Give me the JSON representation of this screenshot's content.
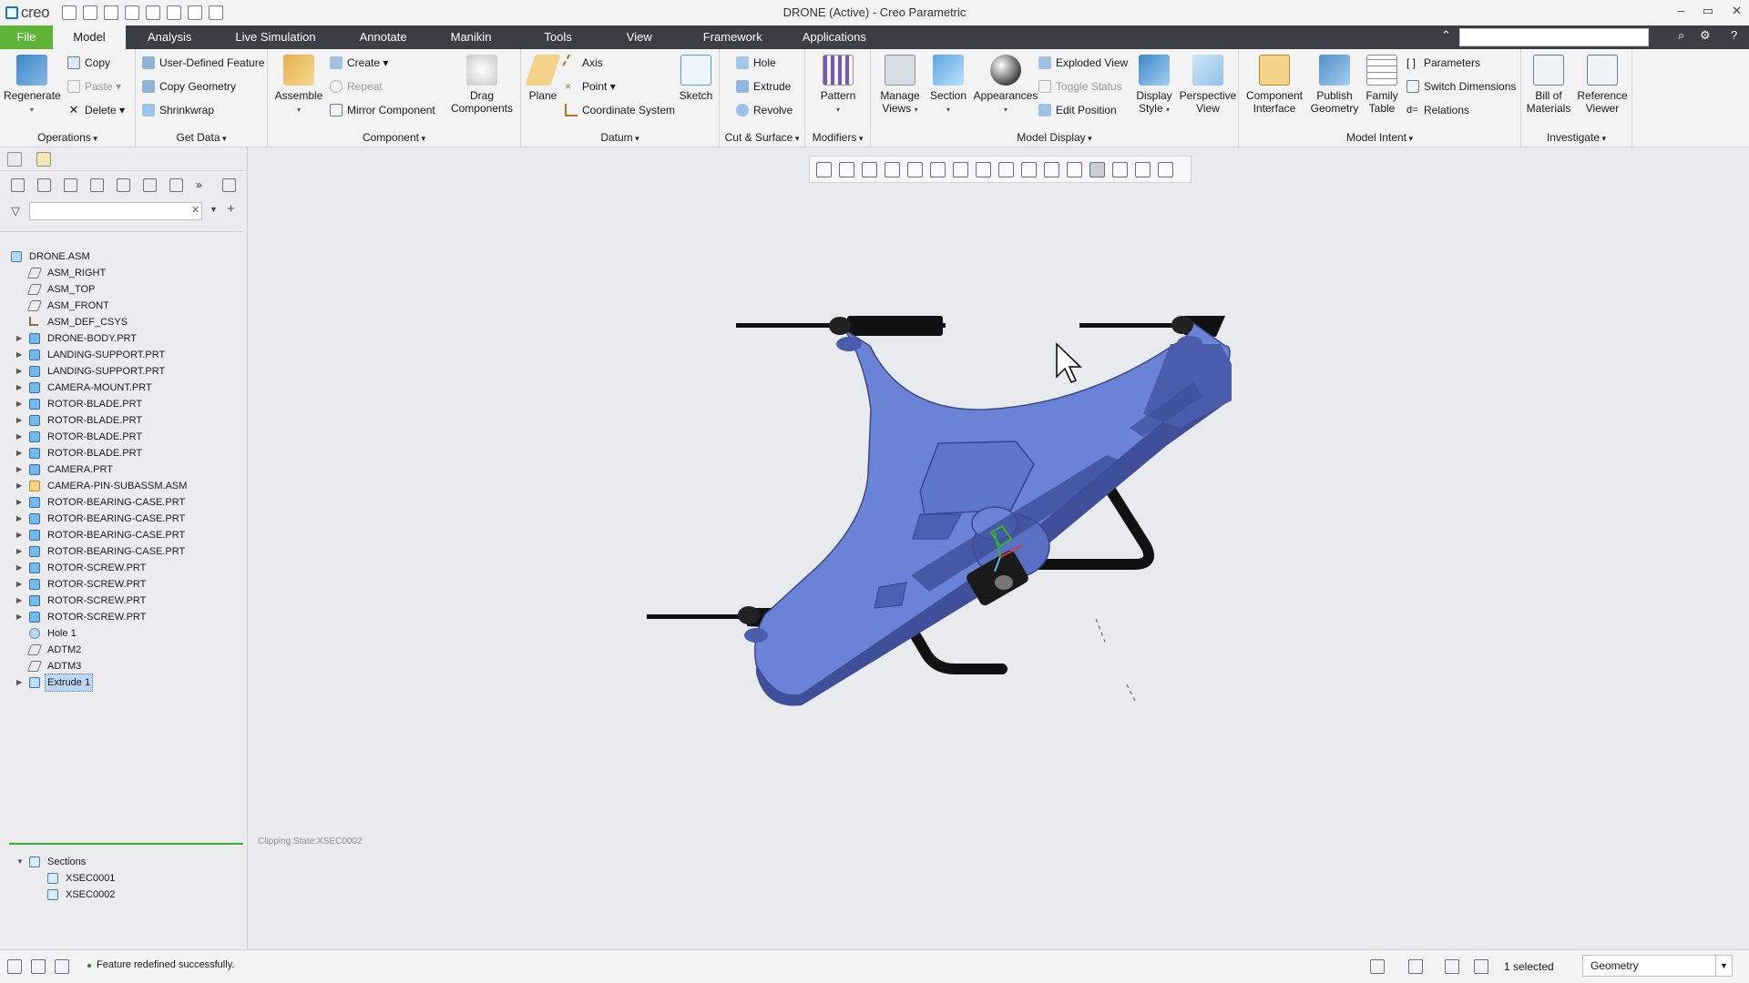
{
  "app": {
    "logo": "creo",
    "window_title": "DRONE (Active) - Creo Parametric",
    "search_placeholder": ""
  },
  "menu": {
    "tabs": [
      "File",
      "Model",
      "Analysis",
      "Live Simulation",
      "Annotate",
      "Manikin",
      "Tools",
      "View",
      "Framework",
      "Applications"
    ],
    "active": "Model"
  },
  "ribbon": {
    "operations": {
      "regenerate": "Regenerate",
      "copy": "Copy",
      "paste": "Paste",
      "delete": "Delete",
      "label": "Operations"
    },
    "get_data": {
      "udf": "User-Defined Feature",
      "copy_geometry": "Copy Geometry",
      "shrinkwrap": "Shrinkwrap",
      "label": "Get Data"
    },
    "component": {
      "assemble": "Assemble",
      "create": "Create",
      "repeat": "Repeat",
      "mirror": "Mirror Component",
      "drag": [
        "Drag",
        "Components"
      ],
      "label": "Component"
    },
    "datum": {
      "plane": "Plane",
      "axis": "Axis",
      "point": "Point",
      "csys": "Coordinate System",
      "sketch": "Sketch",
      "label": "Datum"
    },
    "cut_surface": {
      "hole": "Hole",
      "extrude": "Extrude",
      "revolve": "Revolve",
      "label": "Cut & Surface"
    },
    "modifiers": {
      "pattern": "Pattern",
      "label": "Modifiers"
    },
    "model_display": {
      "manage_views": [
        "Manage",
        "Views"
      ],
      "section": "Section",
      "appearances": "Appearances",
      "exploded": "Exploded View",
      "toggle_status": "Toggle Status",
      "edit_position": "Edit Position",
      "display_style": [
        "Display",
        "Style"
      ],
      "perspective": [
        "Perspective",
        "View"
      ],
      "label": "Model Display"
    },
    "model_intent": {
      "component_interface": [
        "Component",
        "Interface"
      ],
      "publish_geometry": [
        "Publish",
        "Geometry"
      ],
      "family_table": [
        "Family",
        "Table"
      ],
      "parameters": "Parameters",
      "switch_dimensions": "Switch Dimensions",
      "relations": "Relations",
      "label": "Model Intent"
    },
    "investigate": {
      "bom": [
        "Bill of",
        "Materials"
      ],
      "reference_viewer": [
        "Reference",
        "Viewer"
      ],
      "label": "Investigate"
    }
  },
  "tree": {
    "root": "DRONE.ASM",
    "items": [
      {
        "label": "ASM_RIGHT",
        "icon": "datum-plane-icon"
      },
      {
        "label": "ASM_TOP",
        "icon": "datum-plane-icon"
      },
      {
        "label": "ASM_FRONT",
        "icon": "datum-plane-icon"
      },
      {
        "label": "ASM_DEF_CSYS",
        "icon": "csys-icon"
      },
      {
        "label": "DRONE-BODY.PRT",
        "icon": "part-icon"
      },
      {
        "label": "LANDING-SUPPORT.PRT",
        "icon": "part-icon"
      },
      {
        "label": "LANDING-SUPPORT.PRT",
        "icon": "part-icon"
      },
      {
        "label": "CAMERA-MOUNT.PRT",
        "icon": "part-icon"
      },
      {
        "label": "ROTOR-BLADE.PRT",
        "icon": "part-icon"
      },
      {
        "label": "ROTOR-BLADE.PRT",
        "icon": "part-icon"
      },
      {
        "label": "ROTOR-BLADE.PRT",
        "icon": "part-icon"
      },
      {
        "label": "ROTOR-BLADE.PRT",
        "icon": "part-icon"
      },
      {
        "label": "CAMERA.PRT",
        "icon": "part-icon"
      },
      {
        "label": "CAMERA-PIN-SUBASSM.ASM",
        "icon": "subassembly-icon"
      },
      {
        "label": "ROTOR-BEARING-CASE.PRT",
        "icon": "part-icon"
      },
      {
        "label": "ROTOR-BEARING-CASE.PRT",
        "icon": "part-icon"
      },
      {
        "label": "ROTOR-BEARING-CASE.PRT",
        "icon": "part-icon"
      },
      {
        "label": "ROTOR-BEARING-CASE.PRT",
        "icon": "part-icon"
      },
      {
        "label": "ROTOR-SCREW.PRT",
        "icon": "part-icon"
      },
      {
        "label": "ROTOR-SCREW.PRT",
        "icon": "part-icon"
      },
      {
        "label": "ROTOR-SCREW.PRT",
        "icon": "part-icon"
      },
      {
        "label": "ROTOR-SCREW.PRT",
        "icon": "part-icon"
      },
      {
        "label": "Hole 1",
        "icon": "hole-icon"
      },
      {
        "label": "ADTM2",
        "icon": "datum-plane-icon"
      },
      {
        "label": "ADTM3",
        "icon": "datum-plane-icon"
      },
      {
        "label": "Extrude 1",
        "icon": "extrude-icon"
      }
    ],
    "sections_label": "Sections",
    "sections": [
      "XSEC0001",
      "XSEC0002"
    ]
  },
  "viewport": {
    "clipping_state": "Clipping State:XSEC0002"
  },
  "status": {
    "message": "Feature redefined successfully.",
    "selected": "1 selected",
    "filter": "Geometry"
  },
  "colors": {
    "accent_green": "#5fb336",
    "menubar": "#3b3f45",
    "model_blue": "#6a82d4"
  }
}
